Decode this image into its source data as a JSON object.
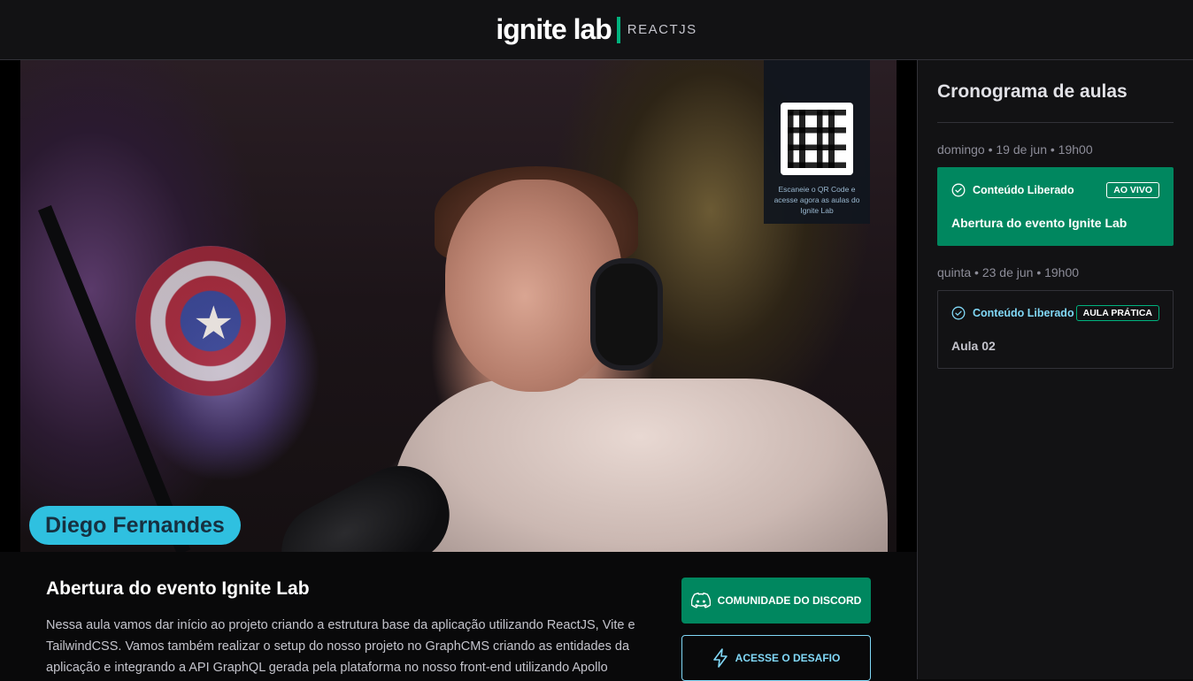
{
  "header": {
    "logo_text": "ignite lab",
    "logo_sub": "REACTJS"
  },
  "video": {
    "qr_caption": "Escaneie o QR Code e acesse agora as aulas do Ignite Lab",
    "speaker_name": "Diego Fernandes"
  },
  "lesson": {
    "title": "Abertura do evento Ignite Lab",
    "description": "Nessa aula vamos dar início ao projeto criando a estrutura base da aplicação utilizando ReactJS, Vite e TailwindCSS. Vamos também realizar o setup do nosso projeto no GraphCMS criando as entidades da aplicação e integrando a API GraphQL gerada pela plataforma no nosso front-end utilizando Apollo"
  },
  "actions": {
    "discord_label": "COMUNIDADE DO DISCORD",
    "challenge_label": "ACESSE O DESAFIO"
  },
  "sidebar": {
    "title": "Cronograma de aulas",
    "lessons": [
      {
        "date": "domingo • 19 de jun • 19h00",
        "status": "Conteúdo Liberado",
        "badge": "AO VIVO",
        "title": "Abertura do evento Ignite Lab",
        "active": true
      },
      {
        "date": "quinta • 23 de jun • 19h00",
        "status": "Conteúdo Liberado",
        "badge": "AULA PRÁTICA",
        "title": "Aula 02",
        "active": false
      }
    ]
  },
  "colors": {
    "brand_green": "#00875f",
    "accent_blue": "#81d8f7",
    "background": "#09090a",
    "panel": "#121214"
  },
  "icons": {
    "status": "check-circle-icon",
    "discord": "discord-logo-icon",
    "challenge": "lightning-icon"
  }
}
